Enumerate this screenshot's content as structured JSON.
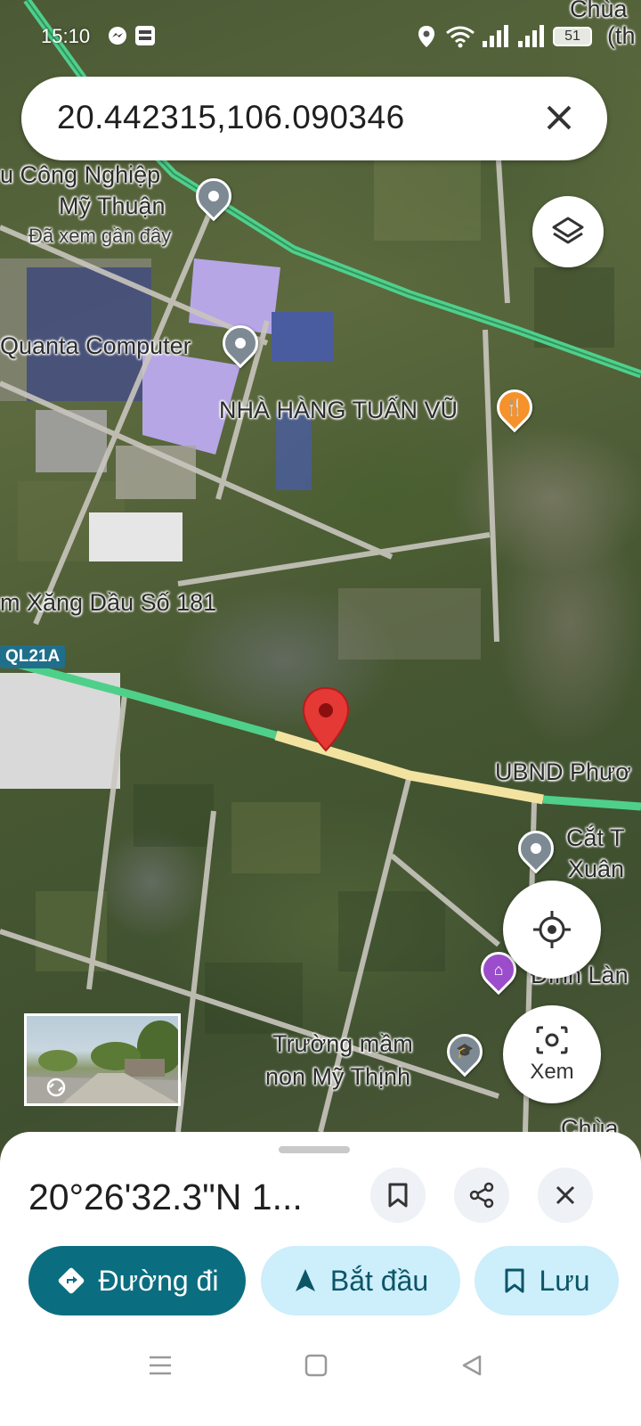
{
  "status_bar": {
    "time": "15:10",
    "battery": "51",
    "icons": [
      "messenger-icon",
      "baomoi-icon",
      "location-icon",
      "wifi-icon",
      "signal-icon",
      "signal-icon",
      "battery-icon"
    ]
  },
  "search": {
    "query": "20.442315,106.090346",
    "clear_icon": "close-icon"
  },
  "map": {
    "labels": {
      "kcn_line1": "u Công Nghiệp",
      "kcn_line2": "Mỹ Thuận",
      "kcn_sub": "Đã xem gần đây",
      "quanta": "Quanta Computer",
      "restaurant": "NHÀ HÀNG TUẤN VŨ",
      "gas_station": "m Xăng Dầu Số 181",
      "ubnd": "UBND Phươ",
      "cat_line1": "Cắt T",
      "cat_line2": "Xuân",
      "dinh": "Đình Làn",
      "school_line1": "Trường mầm",
      "school_line2": "non Mỹ Thịnh",
      "chua_top_line1": "Chùa",
      "chua_top_line2": "(th",
      "chua_bottom": "Chùa"
    },
    "route_shield": "QL21A",
    "colors": {
      "highway": "#4fd08a",
      "road": "#f3e3a0",
      "pin": "#e53935",
      "restaurant_poi": "#f5922b",
      "temple_poi": "#9c4dcc",
      "generic_poi": "#7d8a94"
    }
  },
  "buttons": {
    "layers_icon": "layers-icon",
    "locate_icon": "my-location-icon",
    "view_label": "Xem",
    "view_icon": "camera-icon"
  },
  "sheet": {
    "title": "20°26'32.3\"N 1...",
    "directions_label": "Đường đi",
    "start_label": "Bắt đầu",
    "save_label": "Lưu",
    "colors": {
      "primary": "#0b6e80",
      "secondary_bg": "#cdeefb"
    }
  },
  "nav_bar": {
    "icons": [
      "menu-icon",
      "home-icon",
      "back-icon"
    ]
  }
}
